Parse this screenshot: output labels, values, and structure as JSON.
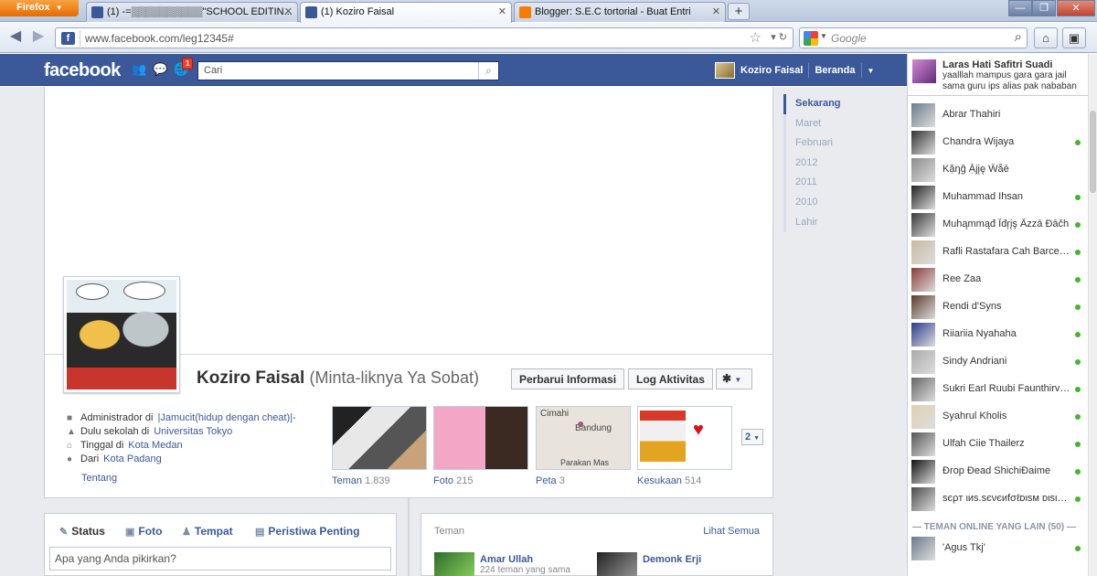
{
  "browser": {
    "menu_label": "Firefox",
    "tabs": [
      {
        "title": "(1) -=▒▒▒▒▒▒▒▒▒▒\"SCHOOL EDITIN...",
        "active": false,
        "favicon": "facebook-icon"
      },
      {
        "title": "(1) Koziro Faisal",
        "active": true,
        "favicon": "facebook-icon"
      },
      {
        "title": "Blogger: S.E.C tortorial - Buat Entri",
        "active": false,
        "favicon": "blogger-icon"
      }
    ],
    "url": "www.facebook.com/leg12345#",
    "search_placeholder": "Google"
  },
  "fb": {
    "logo": "facebook",
    "notif_count": "1",
    "search_placeholder": "Cari",
    "user_name": "Koziro Faisal",
    "home_label": "Beranda"
  },
  "profile": {
    "name": "Koziro Faisal",
    "alt_name": "(Minta-liknya Ya Sobat)",
    "update_info_label": "Perbarui Informasi",
    "activity_log_label": "Log Aktivitas",
    "info": [
      {
        "prefix": "Administrador di ",
        "link": "|Jamucit(hidup dengan cheat)|-"
      },
      {
        "prefix": "Dulu sekolah di ",
        "link": "Universitas Tokyo"
      },
      {
        "prefix": "Tinggal di ",
        "link": "Kota Medan"
      },
      {
        "prefix": "Dari ",
        "link": "Kota Padang"
      }
    ],
    "about_label": "Tentang",
    "tiles": [
      {
        "label": "Teman",
        "count": "1.839"
      },
      {
        "label": "Foto",
        "count": "215"
      },
      {
        "label": "Peta",
        "count": "3"
      },
      {
        "label": "Kesukaan",
        "count": "514"
      }
    ],
    "map_labels": {
      "city1": "Cimahi",
      "city2": "Bandung",
      "city3": "Parakan Mas"
    },
    "more_count": "2"
  },
  "timeline_nav": [
    "Sekarang",
    "Maret",
    "Februari",
    "2012",
    "2011",
    "2010",
    "Lahir"
  ],
  "composer": {
    "tabs": [
      "Status",
      "Foto",
      "Tempat",
      "Peristiwa Penting"
    ],
    "placeholder": "Apa yang Anda pikirkan?"
  },
  "friends_box": {
    "title": "Teman",
    "see_all": "Lihat Semua",
    "friends": [
      {
        "name": "Amar Ullah",
        "sub": "224 teman yang sama"
      },
      {
        "name": "Demonk Erji",
        "sub": ""
      }
    ]
  },
  "chat": {
    "ticker": {
      "name": "Laras Hati Safitri Suadi",
      "text": "yaalllah mampus gara gara jail sama guru ips alias pak nababan"
    },
    "online": [
      {
        "name": "Abrar Thahiri",
        "dot": false
      },
      {
        "name": "Chandra Wijaya",
        "dot": true
      },
      {
        "name": "Kặŋĝ Ặjįę Ŵåē",
        "dot": false
      },
      {
        "name": "Muhammad Ihsan",
        "dot": true
      },
      {
        "name": "Muĥąmmąđ Ĩđŗįş Ãzzā Đāčh",
        "dot": true
      },
      {
        "name": "Rafli Rastafara Cah Barcelona",
        "dot": true
      },
      {
        "name": "Ree Zaa",
        "dot": true
      },
      {
        "name": "Rendi d'Syns",
        "dot": true
      },
      {
        "name": "Riiariia Nyahaha",
        "dot": true
      },
      {
        "name": "Sindy Andriani",
        "dot": true
      },
      {
        "name": "Sukri Earl Ruubi Faunthirverson",
        "dot": true
      },
      {
        "name": "Syahrul Kholis",
        "dot": true
      },
      {
        "name": "Ulfah Ciie Thailerz",
        "dot": true
      },
      {
        "name": "Đrop Đead ShichiĐaime",
        "dot": true
      },
      {
        "name": "ѕєρт ιиѕ.ѕєνєиfσℓᴅιsм ᴅιsιρ...",
        "dot": true
      }
    ],
    "others_label": "— TEMAN ONLINE YANG LAIN (50) —",
    "others": [
      {
        "name": "'Agus Tkj'",
        "dot": true
      }
    ]
  }
}
